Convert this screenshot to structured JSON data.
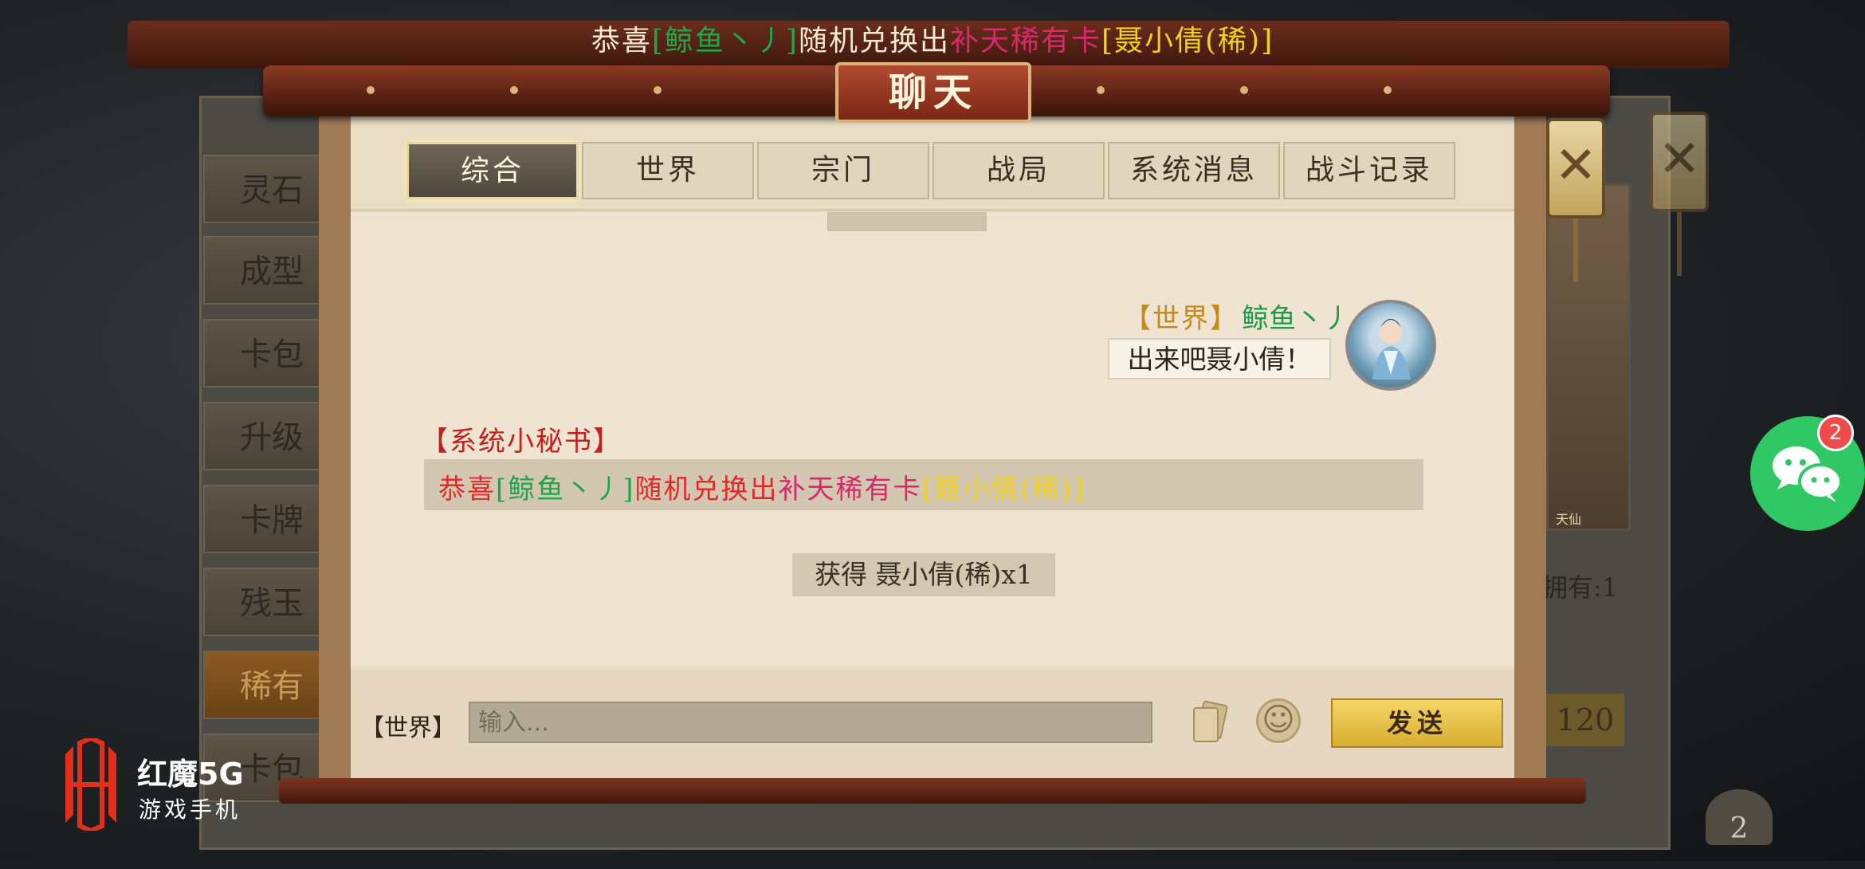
{
  "announcement": {
    "prefix": "恭喜",
    "name": "[鲸鱼丶丿]",
    "action": "随机兑换出",
    "card_type": "补天稀有卡",
    "card": "[聂小倩(稀)]"
  },
  "window": {
    "title": "聊天"
  },
  "tabs": [
    "综合",
    "世界",
    "宗门",
    "战局",
    "系统消息",
    "战斗记录"
  ],
  "active_tab": "综合",
  "messages": {
    "world": {
      "channel": "【世界】",
      "sender": "鲸鱼丶丿",
      "text": "出来吧聂小倩！"
    },
    "system": {
      "channel": "【系统小秘书】",
      "prefix": "恭喜",
      "name": "[鲸鱼丶丿]",
      "action": "随机兑换出",
      "card_type": "补天稀有卡",
      "card": "[聂小倩(稀)]"
    },
    "gain": "获得 聂小倩(稀)x1"
  },
  "input": {
    "channel": "【世界】",
    "placeholder": "输入...",
    "send_label": "发送"
  },
  "background": {
    "side_menu": [
      "灵石",
      "成型",
      "卡包",
      "升级",
      "卡牌",
      "残玉",
      "稀有",
      "卡包"
    ],
    "card_title": "天仙",
    "owned": "拥有:1",
    "price": "120",
    "corner_count": "2"
  },
  "chat_widget": {
    "badge": "2"
  },
  "logo": {
    "title": "红魔5G",
    "subtitle": "游戏手机"
  },
  "colors": {
    "green_name": "#1fa64a",
    "red_text": "#e02a2a",
    "pink_text": "#d62a6a",
    "yellow_card": "#f0d21c",
    "world_tag": "#c48a1a",
    "send_button": "#e8c24a",
    "chat_widget": "#2fc864"
  }
}
